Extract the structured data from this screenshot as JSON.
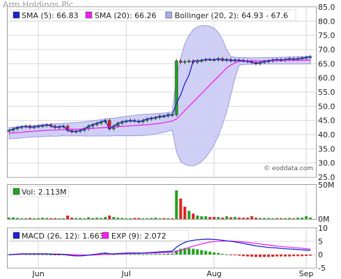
{
  "title": "Arm Holdings Plc",
  "watermark": "© eoddata.com",
  "colors": {
    "up": "#22a022",
    "down": "#dd2222",
    "sma5": "#1a22cc",
    "sma20": "#ee22ee",
    "band_fill": "#c8c8f4",
    "band_stroke": "#9a9ae0",
    "grid": "#d8d8d8",
    "macd": "#1a22cc",
    "signal": "#ee22ee"
  },
  "chart_data": [
    {
      "type": "line",
      "name": "price",
      "legend": [
        {
          "label": "SMA (5): 66.83",
          "color": "#1a22cc"
        },
        {
          "label": "SMA (20): 66.26",
          "color": "#ee22ee"
        },
        {
          "label": "Bollinger (20, 2): 64.93 - 67.6",
          "color": "#aaaaee"
        }
      ],
      "ylim": [
        25,
        85
      ],
      "yticks": [
        "85.0",
        "80.0",
        "75.0",
        "70.0",
        "65.0",
        "60.0",
        "55.0",
        "50.0",
        "45.0",
        "40.0",
        "35.0",
        "30.0",
        "25.0"
      ],
      "xlim": [
        0,
        73
      ],
      "xticks": [
        {
          "x": 7,
          "label": "Jun"
        },
        {
          "x": 28,
          "label": "Jul"
        },
        {
          "x": 49,
          "label": "Aug"
        },
        {
          "x": 71,
          "label": "Sep"
        }
      ],
      "close": [
        41.5,
        42,
        42.5,
        42.8,
        43,
        42.5,
        42.8,
        43,
        43.2,
        43.5,
        43,
        42.5,
        42.8,
        43,
        41.5,
        41,
        41.2,
        41.5,
        42,
        43,
        43.5,
        44,
        44.5,
        45,
        42,
        43,
        44,
        44.5,
        44.8,
        45,
        44.8,
        44.5,
        45,
        45.5,
        45.8,
        46,
        46.5,
        46.5,
        47,
        47,
        66,
        65.5,
        65.8,
        66,
        65.5,
        66,
        66.2,
        66.5,
        66.5,
        66.3,
        66.8,
        66.2,
        66.5,
        66,
        66.3,
        66.2,
        66,
        65.8,
        65.5,
        65,
        65.5,
        65.8,
        66,
        66.3,
        66.5,
        66.2,
        66.5,
        66.8,
        66.5,
        66.8,
        67,
        67.2,
        67.5
      ],
      "sma5": [
        41.5,
        42,
        42.5,
        42.8,
        43,
        42.5,
        42.8,
        43,
        43.2,
        43.5,
        43,
        42.5,
        42.8,
        43,
        41.5,
        41,
        41.2,
        41.5,
        42,
        43,
        43.5,
        44,
        44.5,
        45,
        42,
        43,
        44,
        44.5,
        44.8,
        45,
        44.8,
        44.5,
        45,
        45.5,
        45.8,
        46,
        46.5,
        46.5,
        47,
        47,
        51,
        54,
        58,
        61,
        66,
        66,
        66.2,
        66.5,
        66.5,
        66.3,
        66.8,
        66.2,
        66.5,
        66,
        66.3,
        66.2,
        66,
        65.8,
        65.5,
        65,
        65.5,
        65.8,
        66,
        66.3,
        66.5,
        66.2,
        66.5,
        66.8,
        66.5,
        66.8,
        67,
        67.2,
        67.5
      ],
      "sma20": [
        40.5,
        40.6,
        40.7,
        40.8,
        41,
        41.1,
        41.2,
        41.3,
        41.4,
        41.5,
        41.6,
        41.6,
        41.7,
        41.8,
        41.8,
        41.9,
        41.9,
        42,
        42,
        42.1,
        42.2,
        42.3,
        42.4,
        42.5,
        42.6,
        42.7,
        42.8,
        42.9,
        43,
        43.1,
        43.2,
        43.3,
        43.4,
        43.5,
        43.6,
        43.8,
        44,
        44.2,
        44.5,
        44.8,
        45.5,
        47,
        48.5,
        50,
        51.5,
        53,
        54.5,
        56,
        57.5,
        59,
        60.5,
        62,
        63.5,
        64.5,
        65.3,
        65.8,
        65.9,
        66,
        66,
        66,
        66,
        66,
        66,
        66.1,
        66.1,
        66.1,
        66.2,
        66.2,
        66.2,
        66.2,
        66.2,
        66.2,
        66.26
      ],
      "bb_upper": [
        42.5,
        42.6,
        42.7,
        42.8,
        43,
        43.1,
        43.2,
        43.4,
        43.5,
        43.6,
        43.7,
        43.8,
        43.9,
        44,
        44.1,
        44.2,
        44.3,
        44.4,
        44.5,
        44.7,
        44.9,
        45.1,
        45.3,
        45.5,
        45.7,
        45.8,
        46,
        46.2,
        46.4,
        46.6,
        46.8,
        47,
        47.1,
        47.2,
        47.3,
        47.4,
        47.5,
        47.6,
        47.8,
        48,
        60,
        67,
        72,
        75,
        77,
        78,
        78.4,
        78.5,
        78.2,
        77.5,
        76,
        73.5,
        70,
        67.5,
        67.3,
        67.2,
        67.2,
        67.1,
        67.1,
        67.1,
        67.1,
        67.2,
        67.2,
        67.2,
        67.2,
        67.3,
        67.3,
        67.4,
        67.4,
        67.5,
        67.5,
        67.6,
        67.6
      ],
      "bb_lower": [
        38.5,
        38.6,
        38.7,
        38.8,
        39,
        39.1,
        39.2,
        39.2,
        39.3,
        39.4,
        39.5,
        39.4,
        39.5,
        39.6,
        39.5,
        39.6,
        39.5,
        39.6,
        39.5,
        39.5,
        39.5,
        39.5,
        39.5,
        39.5,
        39.5,
        39.6,
        39.6,
        39.6,
        39.6,
        39.6,
        39.6,
        39.6,
        39.7,
        39.8,
        39.9,
        40.2,
        40.5,
        40.8,
        41.2,
        41.6,
        34,
        30.5,
        29.5,
        29,
        29,
        29.5,
        30.5,
        32,
        34,
        36.5,
        39.5,
        43.5,
        48,
        54,
        60,
        64.5,
        64.7,
        64.8,
        64.8,
        64.9,
        64.9,
        64.9,
        64.9,
        64.9,
        64.9,
        64.9,
        64.9,
        64.9,
        64.9,
        64.9,
        64.9,
        64.93,
        64.93
      ]
    },
    {
      "type": "bar",
      "name": "volume",
      "legend": [
        {
          "label": "Vol: 2.113M",
          "color": "#22a022"
        }
      ],
      "ylim": [
        0,
        50
      ],
      "yticks": [
        "50M",
        "0M"
      ],
      "values": [
        2,
        2.5,
        1.5,
        1,
        1.2,
        1.5,
        1,
        1.3,
        2,
        1.5,
        1.2,
        1.2,
        1,
        1,
        5,
        2,
        1.5,
        1.5,
        1,
        2.5,
        1.5,
        2,
        1.5,
        3,
        5,
        3,
        2,
        1.5,
        1,
        1.2,
        1.5,
        1.5,
        1,
        1.2,
        1.5,
        2,
        1,
        1.3,
        1.2,
        1,
        42,
        30,
        18,
        12,
        8,
        5,
        4,
        4,
        3,
        3,
        3,
        2,
        4,
        2.5,
        3,
        2,
        2,
        2,
        4,
        2,
        1.5,
        1.5,
        1.5,
        1,
        1.5,
        1.2,
        1.2,
        1.5,
        1,
        2,
        2,
        4,
        2.113
      ],
      "up": [
        1,
        1,
        1,
        1,
        1,
        0,
        1,
        1,
        1,
        1,
        0,
        0,
        1,
        1,
        0,
        0,
        1,
        1,
        1,
        1,
        1,
        1,
        1,
        1,
        0,
        1,
        1,
        1,
        1,
        1,
        0,
        0,
        1,
        1,
        1,
        1,
        1,
        0,
        1,
        0,
        1,
        0,
        0,
        1,
        0,
        1,
        1,
        1,
        0,
        0,
        1,
        0,
        1,
        0,
        1,
        0,
        0,
        0,
        0,
        0,
        1,
        1,
        1,
        1,
        1,
        0,
        1,
        1,
        0,
        1,
        1,
        1,
        1
      ]
    },
    {
      "type": "line",
      "name": "macd",
      "legend": [
        {
          "label": "MACD (26, 12): 1.663",
          "color": "#1a22cc"
        },
        {
          "label": "EXP (9): 2.072",
          "color": "#ee22ee"
        }
      ],
      "ylim": [
        -5,
        10
      ],
      "yticks": [
        "10",
        "5",
        "0",
        "-5"
      ],
      "macd": [
        0,
        0.1,
        0.2,
        0.3,
        0.3,
        0.3,
        0.3,
        0.3,
        0.3,
        0.3,
        0.2,
        0.1,
        0.1,
        0.1,
        -0.2,
        -0.4,
        -0.5,
        -0.5,
        -0.4,
        -0.2,
        0,
        0.2,
        0.4,
        0.6,
        0.3,
        0.3,
        0.4,
        0.5,
        0.6,
        0.6,
        0.6,
        0.6,
        0.6,
        0.7,
        0.8,
        0.9,
        1,
        1.1,
        1.2,
        1.3,
        2.8,
        3.8,
        4.6,
        5.1,
        5.4,
        5.6,
        5.7,
        5.8,
        5.8,
        5.7,
        5.6,
        5.4,
        5.2,
        5,
        4.8,
        4.5,
        4.2,
        3.9,
        3.6,
        3.3,
        3.1,
        2.9,
        2.7,
        2.6,
        2.5,
        2.3,
        2.2,
        2.1,
        2,
        1.9,
        1.8,
        1.7,
        1.663
      ],
      "signal": [
        0,
        0,
        0.1,
        0.1,
        0.2,
        0.2,
        0.2,
        0.2,
        0.2,
        0.2,
        0.2,
        0.2,
        0.2,
        0.1,
        0.1,
        0,
        -0.1,
        -0.2,
        -0.2,
        -0.2,
        -0.2,
        -0.1,
        0,
        0.1,
        0.1,
        0.2,
        0.2,
        0.3,
        0.3,
        0.4,
        0.4,
        0.4,
        0.5,
        0.5,
        0.6,
        0.6,
        0.7,
        0.8,
        0.8,
        0.9,
        1.2,
        1.6,
        2.1,
        2.7,
        3.2,
        3.6,
        4,
        4.4,
        4.7,
        4.9,
        5,
        5.1,
        5.1,
        5.1,
        5,
        4.9,
        4.8,
        4.6,
        4.4,
        4.2,
        4,
        3.8,
        3.6,
        3.4,
        3.2,
        3,
        2.9,
        2.8,
        2.6,
        2.5,
        2.4,
        2.2,
        2.072
      ]
    }
  ]
}
